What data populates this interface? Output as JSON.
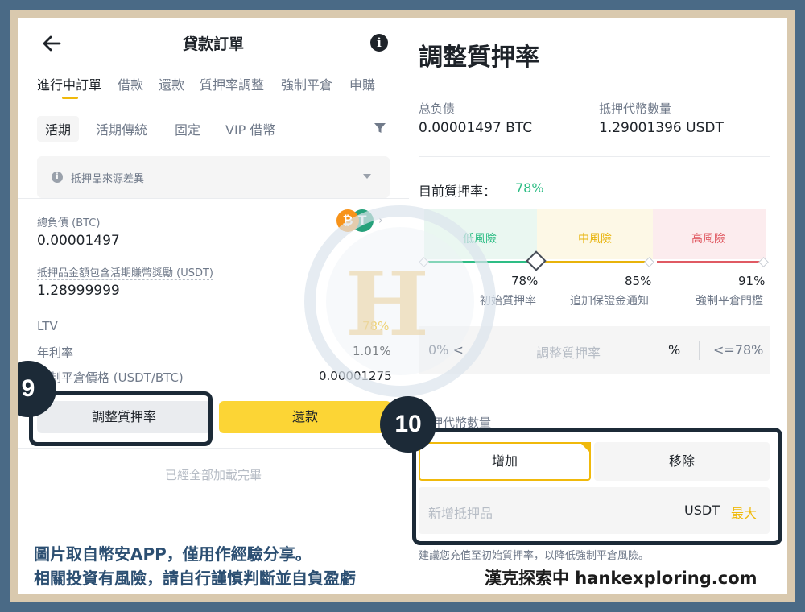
{
  "header": {
    "title": "貸款訂單"
  },
  "tabs": [
    "進行中訂單",
    "借款",
    "還款",
    "質押率調整",
    "強制平倉",
    "申購"
  ],
  "chips": [
    "活期",
    "活期傳統",
    "固定",
    "VIP 借幣"
  ],
  "notice": {
    "text": "抵押品來源差異"
  },
  "loan": {
    "total_debt_label": "總負債 (BTC)",
    "total_debt_value": "0.00001497",
    "collateral_label": "抵押品金額包含活期賺幣獎勵 (USDT)",
    "collateral_value": "1.28999999",
    "ltv_label": "LTV",
    "ltv_value": "78%",
    "apr_label": "年利率",
    "apr_value": "1.01%",
    "liq_label": "強制平倉價格 (USDT/BTC)",
    "liq_value": "0.00001275",
    "coin_btc": "₿",
    "coin_usdt": "T"
  },
  "buttons": {
    "adjust": "調整質押率",
    "repay": "還款"
  },
  "footer": {
    "loaded": "已經全部加載完畢"
  },
  "adjust": {
    "title": "調整質押率",
    "total_debt_label": "总负债",
    "total_debt_value": "0.00001497 BTC",
    "collateral_label": "抵押代幣數量",
    "collateral_value": "1.29001396 USDT",
    "current_label": "目前質押率：",
    "current_value": "78%",
    "risk": [
      {
        "label": "低風險",
        "pct": "78%",
        "desc": "初始質押率",
        "color": "#2ebd85",
        "bg": "#eaf7f1"
      },
      {
        "label": "中風險",
        "pct": "85%",
        "desc": "追加保證金通知",
        "color": "#e8b30b",
        "bg": "#fdf8e6"
      },
      {
        "label": "高風險",
        "pct": "91%",
        "desc": "強制平倉門檻",
        "color": "#e05a63",
        "bg": "#fcecee"
      }
    ],
    "input_prefix": "0% <",
    "input_placeholder": "調整質押率",
    "input_unit": "%",
    "input_suffix": "<=78%",
    "amount_label": "抵押代幣數量",
    "add_label": "增加",
    "remove_label": "移除",
    "add_placeholder": "新增抵押品",
    "add_unit": "USDT",
    "add_max": "最大",
    "hint": "建議您充值至初始質押率，以降低強制平倉風險。"
  },
  "overlay": {
    "step9": "9",
    "step10": "10",
    "caption1": "圖片取自幣安APP，僅用作經驗分享。",
    "caption2": "相關投資有風險，請自行謹慎判斷並自負盈虧",
    "site": "漢克探索中 hankexploring.com",
    "watermark": "H"
  },
  "colors": {
    "accent": "#f0b90b",
    "green": "#2ebd85",
    "frame": "#4a6a86",
    "badge": "#1c2a37"
  }
}
